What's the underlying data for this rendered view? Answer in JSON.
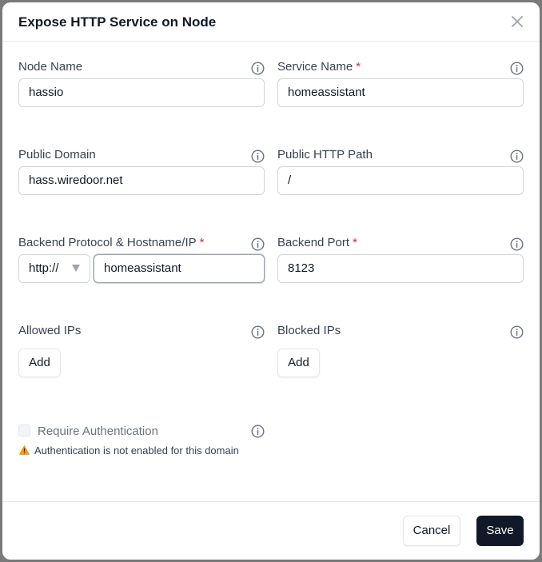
{
  "dialog": {
    "title": "Expose HTTP Service on Node",
    "close_icon": "close-icon"
  },
  "fields": {
    "node_name": {
      "label": "Node Name",
      "required": false,
      "value": "hassio"
    },
    "service_name": {
      "label": "Service Name",
      "required": true,
      "required_mark": "*",
      "value": "homeassistant"
    },
    "public_domain": {
      "label": "Public Domain",
      "required": false,
      "value": "hass.wiredoor.net"
    },
    "public_http_path": {
      "label": "Public HTTP Path",
      "required": false,
      "value": "/"
    },
    "backend_target": {
      "label": "Backend Protocol & Hostname/IP",
      "required": true,
      "required_mark": "*",
      "protocol": "http://",
      "hostname": "homeassistant"
    },
    "backend_port": {
      "label": "Backend Port",
      "required": true,
      "required_mark": "*",
      "value": "8123"
    },
    "allowed_ips": {
      "label": "Allowed IPs",
      "add_label": "Add"
    },
    "blocked_ips": {
      "label": "Blocked IPs",
      "add_label": "Add"
    }
  },
  "auth": {
    "label": "Require Authentication",
    "checked": false,
    "warning_icon": "warning-icon",
    "warning_text": "Authentication is not enabled for this domain"
  },
  "footer": {
    "cancel_label": "Cancel",
    "save_label": "Save"
  },
  "colors": {
    "required": "#dc2626",
    "primary_button": "#111827",
    "warning": "#f59e0b"
  }
}
